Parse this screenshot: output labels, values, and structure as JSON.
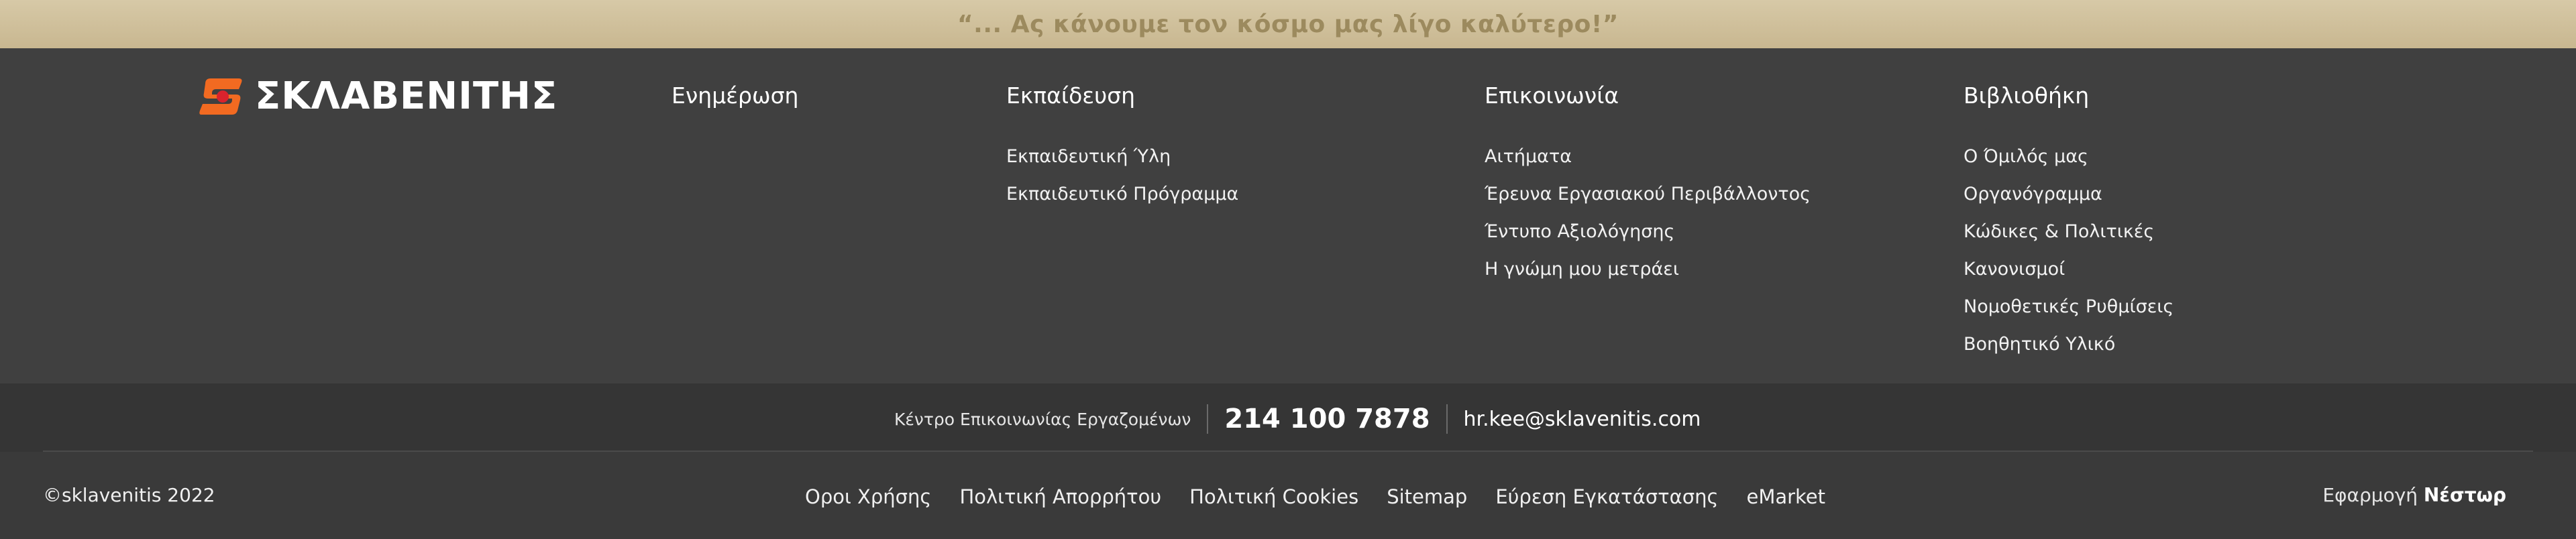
{
  "banner": {
    "slogan": "“... Ας κάνουμε τον κόσμο μας λίγο καλύτερο!”"
  },
  "logo": {
    "text": "ΣΚΛΑΒΕΝΙΤΗΣ",
    "colors": {
      "orange": "#f26a21",
      "red": "#d9232d"
    }
  },
  "columns": [
    {
      "title": "Ενημέρωση",
      "links": []
    },
    {
      "title": "Εκπαίδευση",
      "links": [
        "Εκπαιδευτική Ύλη",
        "Εκπαιδευτικό Πρόγραμμα"
      ]
    },
    {
      "title": "Επικοινωνία",
      "links": [
        "Αιτήματα",
        "Έρευνα Εργασιακού Περιβάλλοντος",
        "Έντυπο Αξιολόγησης",
        "Η γνώμη μου μετράει"
      ]
    },
    {
      "title": "Βιβλιοθήκη",
      "links": [
        "Ο Όμιλός μας",
        "Οργανόγραμμα",
        "Κώδικες & Πολιτικές",
        "Κανονισμοί",
        "Νομοθετικές Ρυθμίσεις",
        "Βοηθητικό Υλικό"
      ]
    }
  ],
  "contact": {
    "label": "Κέντρο Επικοινωνίας Εργαζομένων",
    "phone": "214 100 7878",
    "email": "hr.kee@sklavenitis.com"
  },
  "footer": {
    "copyright": "©sklavenitis 2022",
    "legal_links": [
      "Οροι Χρήσης",
      "Πολιτική Απορρήτου",
      "Πολιτική Cookies",
      "Sitemap",
      "Εύρεση Εγκατάστασης",
      "eMarket"
    ],
    "app_prefix": "Εφαρμογή",
    "app_name": "Νέστωρ"
  }
}
